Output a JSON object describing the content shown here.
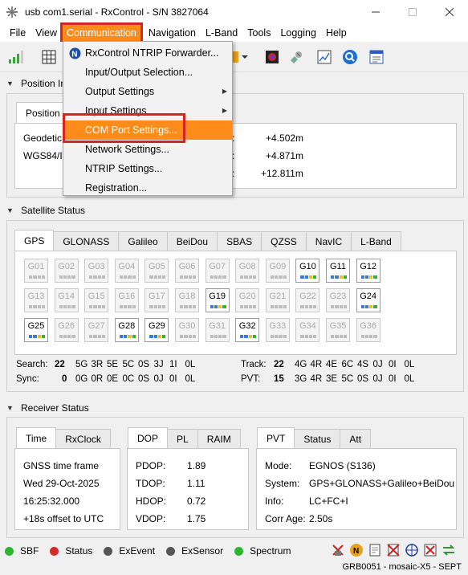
{
  "window": {
    "title": "usb com1.serial - RxControl - S/N 3827064"
  },
  "menubar": [
    "File",
    "View",
    "Communication",
    "Navigation",
    "L-Band",
    "Tools",
    "Logging",
    "Help"
  ],
  "dropdown": [
    {
      "label": "RxControl NTRIP Forwarder...",
      "icon": "ntrip-forwarder-icon"
    },
    {
      "label": "Input/Output Selection..."
    },
    {
      "label": "Output Settings",
      "submenu": true
    },
    {
      "label": "Input Settings",
      "submenu": true
    },
    {
      "label": "COM Port Settings...",
      "highlighted": true
    },
    {
      "label": "Network Settings..."
    },
    {
      "label": "NTRIP Settings..."
    },
    {
      "label": "Registration..."
    }
  ],
  "position": {
    "header": "Position In",
    "tab": "Position",
    "rows": [
      {
        "label": "Geodetic",
        "value": "+4.502m"
      },
      {
        "label": "WGS84/IT",
        "value": "+4.871m"
      },
      {
        "label": "",
        "value": "+12.811m"
      }
    ]
  },
  "satellite_status": {
    "header": "Satellite Status",
    "tabs": [
      "GPS",
      "GLONASS",
      "Galileo",
      "BeiDou",
      "SBAS",
      "QZSS",
      "NavIC",
      "L-Band"
    ],
    "sats": [
      [
        "G01",
        "G02",
        "G03",
        "G04",
        "G05",
        "G06",
        "G07",
        "G08",
        "G09",
        "G10",
        "G11",
        "G12"
      ],
      [
        "G13",
        "G14",
        "G15",
        "G16",
        "G17",
        "G18",
        "G19",
        "G20",
        "G21",
        "G22",
        "G23",
        "G24"
      ],
      [
        "G25",
        "G26",
        "G27",
        "G28",
        "G29",
        "G30",
        "G31",
        "G32",
        "G33",
        "G34",
        "G35",
        "G36"
      ]
    ],
    "active": [
      "G10",
      "G11",
      "G12",
      "G19",
      "G24",
      "G25",
      "G28",
      "G29",
      "G32"
    ],
    "search": {
      "label": "Search:",
      "total": "22",
      "items": [
        "5G",
        "3R",
        "5E",
        "5C",
        "0S",
        "3J",
        "1I",
        "0L"
      ]
    },
    "sync": {
      "label": "Sync:",
      "total": "0",
      "items": [
        "0G",
        "0R",
        "0E",
        "0C",
        "0S",
        "0J",
        "0I",
        "0L"
      ]
    },
    "track": {
      "label": "Track:",
      "total": "22",
      "items": [
        "4G",
        "4R",
        "4E",
        "6C",
        "4S",
        "0J",
        "0I",
        "0L"
      ]
    },
    "pvt": {
      "label": "PVT:",
      "total": "15",
      "items": [
        "3G",
        "4R",
        "3E",
        "5C",
        "0S",
        "0J",
        "0I",
        "0L"
      ]
    }
  },
  "receiver_status": {
    "header": "Receiver Status",
    "time_tabs": [
      "Time",
      "RxClock"
    ],
    "time_lines": [
      "GNSS time frame",
      "Wed 29-Oct-2025",
      "16:25:32.000",
      "+18s offset to UTC"
    ],
    "dop_tabs": [
      "DOP",
      "PL",
      "RAIM"
    ],
    "dop": [
      {
        "label": "PDOP:",
        "value": "1.89"
      },
      {
        "label": "TDOP:",
        "value": "1.11"
      },
      {
        "label": "HDOP:",
        "value": "0.72"
      },
      {
        "label": "VDOP:",
        "value": "1.75"
      }
    ],
    "pvt_tabs": [
      "PVT",
      "Status",
      "Att"
    ],
    "pvt": [
      {
        "label": "Mode:",
        "value": "EGNOS (S136)"
      },
      {
        "label": "System:",
        "value": "GPS+GLONASS+Galileo+BeiDou"
      },
      {
        "label": "Info:",
        "value": "LC+FC+I"
      },
      {
        "label": "Corr Age:",
        "value": "2.50s"
      }
    ]
  },
  "statusbar": [
    {
      "label": "SBF",
      "color": "#2db52d"
    },
    {
      "label": "Status",
      "color": "#d42a2a"
    },
    {
      "label": "ExEvent",
      "color": "#555555"
    },
    {
      "label": "ExSensor",
      "color": "#555555"
    },
    {
      "label": "Spectrum",
      "color": "#2db52d"
    }
  ],
  "footer": "GRB0051 - mosaic-X5 - SEPT"
}
